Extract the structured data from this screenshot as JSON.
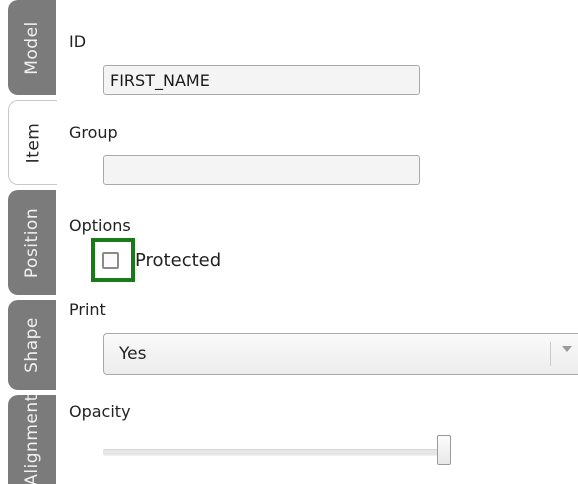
{
  "tabs": [
    {
      "label": "Model",
      "active": false
    },
    {
      "label": "Item",
      "active": true
    },
    {
      "label": "Position",
      "active": false
    },
    {
      "label": "Shape",
      "active": false
    },
    {
      "label": "Alignment",
      "active": false
    }
  ],
  "panel": {
    "id_label": "ID",
    "id_value": "FIRST_NAME",
    "group_label": "Group",
    "group_value": "",
    "options_label": "Options",
    "protected_label": "Protected",
    "protected_checked": false,
    "print_label": "Print",
    "print_value": "Yes",
    "opacity_label": "Opacity",
    "opacity_level": 0.97
  },
  "colors": {
    "tab_inactive": "#7b7b7b",
    "highlight": "#1a7a1a"
  },
  "icons": {
    "select_arrow": "chevron-down-icon"
  }
}
